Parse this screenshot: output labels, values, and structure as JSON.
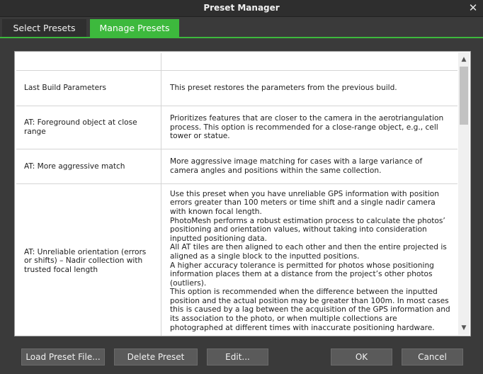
{
  "window": {
    "title": "Preset Manager",
    "close_glyph": "✕"
  },
  "tabs": [
    {
      "label": "Select Presets",
      "active": false
    },
    {
      "label": "Manage Presets",
      "active": true
    }
  ],
  "presets": [
    {
      "name": "",
      "description": [
        ""
      ]
    },
    {
      "name": "Last Build Parameters",
      "description": [
        "This preset restores the parameters from the previous build."
      ]
    },
    {
      "name": "AT: Foreground object at close range",
      "description": [
        "Prioritizes features that are closer to the camera in the aerotriangulation process. This option is recommended for a close-range object, e.g., cell tower or statue."
      ]
    },
    {
      "name": "AT: More aggressive match",
      "description": [
        "More aggressive image matching for cases with a large variance of camera angles and positions within the same collection."
      ]
    },
    {
      "name": "AT: Unreliable orientation (errors or shifts) – Nadir collection with trusted focal length",
      "description": [
        "Use this preset when you have unreliable GPS information with position errors greater than 100 meters or time shift and a single nadir camera with known focal length.",
        "PhotoMesh performs a robust estimation process to calculate the photos’ positioning and orientation values, without taking into consideration inputted positioning data.",
        "All AT tiles are then aligned to each other and then the entire projected is aligned as a single block to the inputted positions.",
        "A higher accuracy tolerance is permitted for photos whose positioning information places them at a distance from the project’s other photos (outliers).",
        "This option is recommended when the difference between the inputted position and the actual position may be greater than 100m. In most cases this is caused by a lag between the acquisition of the GPS information and its association to the photo, or when multiple collections are photographed at different times with inaccurate positioning hardware."
      ]
    }
  ],
  "buttons": {
    "load": "Load Preset File...",
    "delete": "Delete Preset",
    "edit": "Edit...",
    "ok": "OK",
    "cancel": "Cancel"
  },
  "colors": {
    "accent": "#3db93d",
    "background": "#3a3a3a",
    "button": "#5a5a5a"
  },
  "icons": {
    "close": "close-icon",
    "scroll_up": "chevron-up-icon",
    "scroll_down": "chevron-down-icon"
  }
}
